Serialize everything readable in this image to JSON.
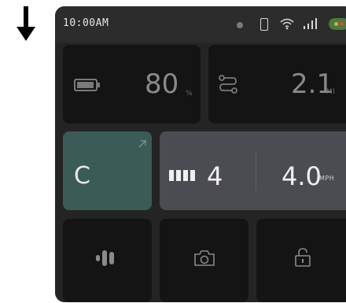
{
  "statusbar": {
    "time": "10:00AM"
  },
  "battery": {
    "value": "80",
    "unit": "%"
  },
  "distance": {
    "value": "2.1",
    "unit": "MI"
  },
  "mode": {
    "label": "C"
  },
  "speed": {
    "gear": "4",
    "value": "4.0",
    "unit": "MPH"
  },
  "controls": {
    "lights_icon": "lights-icon",
    "camera_icon": "camera-icon",
    "lock_icon": "unlock-icon"
  },
  "colors": {
    "background": "#242424",
    "tile": "#141414",
    "mode_tile": "#3b5b57",
    "speed_tile": "#4b4b52",
    "status_pill": "#4a7a3c"
  }
}
